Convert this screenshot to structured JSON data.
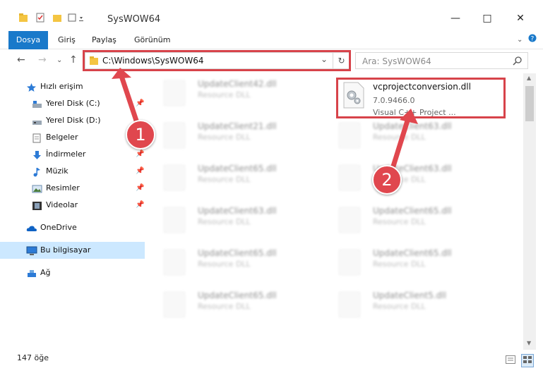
{
  "window": {
    "title": "SysWOW64"
  },
  "ribbon": {
    "tabs": [
      "Dosya",
      "Giriş",
      "Paylaş",
      "Görünüm"
    ]
  },
  "navigation": {
    "address": "C:\\Windows\\SysWOW64",
    "search_placeholder": "Ara: SysWOW64"
  },
  "sidebar": {
    "quick_access": "Hızlı erişim",
    "items": [
      {
        "label": "Yerel Disk (C:)"
      },
      {
        "label": "Yerel Disk (D:)"
      },
      {
        "label": "Belgeler"
      },
      {
        "label": "İndirmeler"
      },
      {
        "label": "Müzik"
      },
      {
        "label": "Resimler"
      },
      {
        "label": "Videolar"
      }
    ],
    "onedrive": "OneDrive",
    "this_pc": "Bu bilgisayar",
    "network": "Ağ"
  },
  "files": {
    "highlighted": {
      "name": "vcprojectconversion.dll",
      "version": "7.0.9466.0",
      "type": "Visual C++ Project ..."
    },
    "left_column": [
      {
        "name": "UpdateClient42.dll",
        "type": "Resource DLL"
      },
      {
        "name": "UpdateClient21.dll",
        "type": "Resource DLL"
      },
      {
        "name": "UpdateClient65.dll",
        "type": "Resource DLL"
      },
      {
        "name": "UpdateClient63.dll",
        "type": "Resource DLL"
      },
      {
        "name": "UpdateClient65.dll",
        "type": "Resource DLL"
      },
      {
        "name": "UpdateClient65.dll",
        "type": "Resource DLL"
      }
    ],
    "right_column": [
      {
        "name": "UpdateClient63.dll",
        "type": "Resource DLL"
      },
      {
        "name": "UpdateClient63.dll",
        "type": "Resource DLL"
      },
      {
        "name": "UpdateClient65.dll",
        "type": "Resource DLL"
      },
      {
        "name": "UpdateClient65.dll",
        "type": "Resource DLL"
      },
      {
        "name": "UpdateClient5.dll",
        "type": "Resource DLL"
      }
    ]
  },
  "status": {
    "item_count": "147 öğe"
  },
  "callouts": [
    "1",
    "2"
  ],
  "colors": {
    "accent": "#1979ca",
    "highlight": "#d7434a",
    "selected": "#cce8ff"
  }
}
